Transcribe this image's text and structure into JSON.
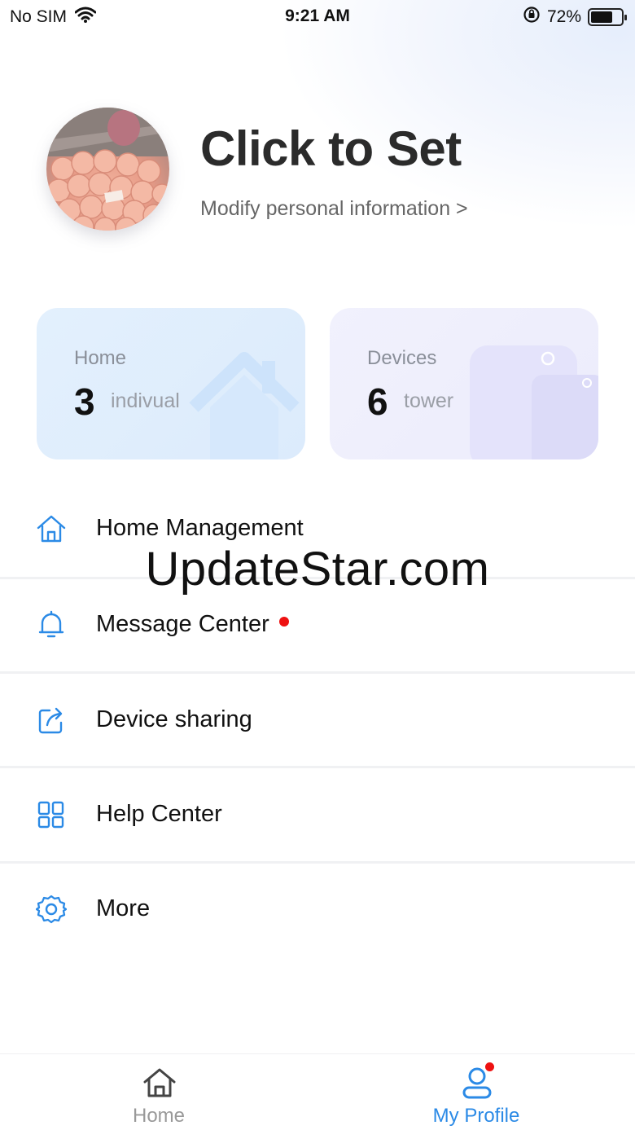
{
  "status_bar": {
    "carrier": "No SIM",
    "time": "9:21 AM",
    "battery_text": "72%",
    "battery_level": 0.72
  },
  "profile": {
    "name": "Click to Set",
    "subtitle": "Modify personal information >"
  },
  "cards": {
    "home": {
      "label": "Home",
      "value": "3",
      "unit": "indivual",
      "icon": "house-icon"
    },
    "devices": {
      "label": "Devices",
      "value": "6",
      "unit": "tower",
      "icon": "device-icon"
    }
  },
  "menu": [
    {
      "label": "Home Management",
      "icon": "home-outline-icon"
    },
    {
      "label": "Message Center",
      "icon": "bell-icon",
      "badge": true
    },
    {
      "label": "Device sharing",
      "icon": "share-icon"
    },
    {
      "label": "Help Center",
      "icon": "grid-icon"
    },
    {
      "label": "More",
      "icon": "gear-icon"
    }
  ],
  "watermark": "UpdateStar.com",
  "tab_bar": {
    "home_label": "Home",
    "profile_label": "My Profile"
  },
  "colors": {
    "accent": "#2b8ae6",
    "badge": "#ee1111"
  }
}
